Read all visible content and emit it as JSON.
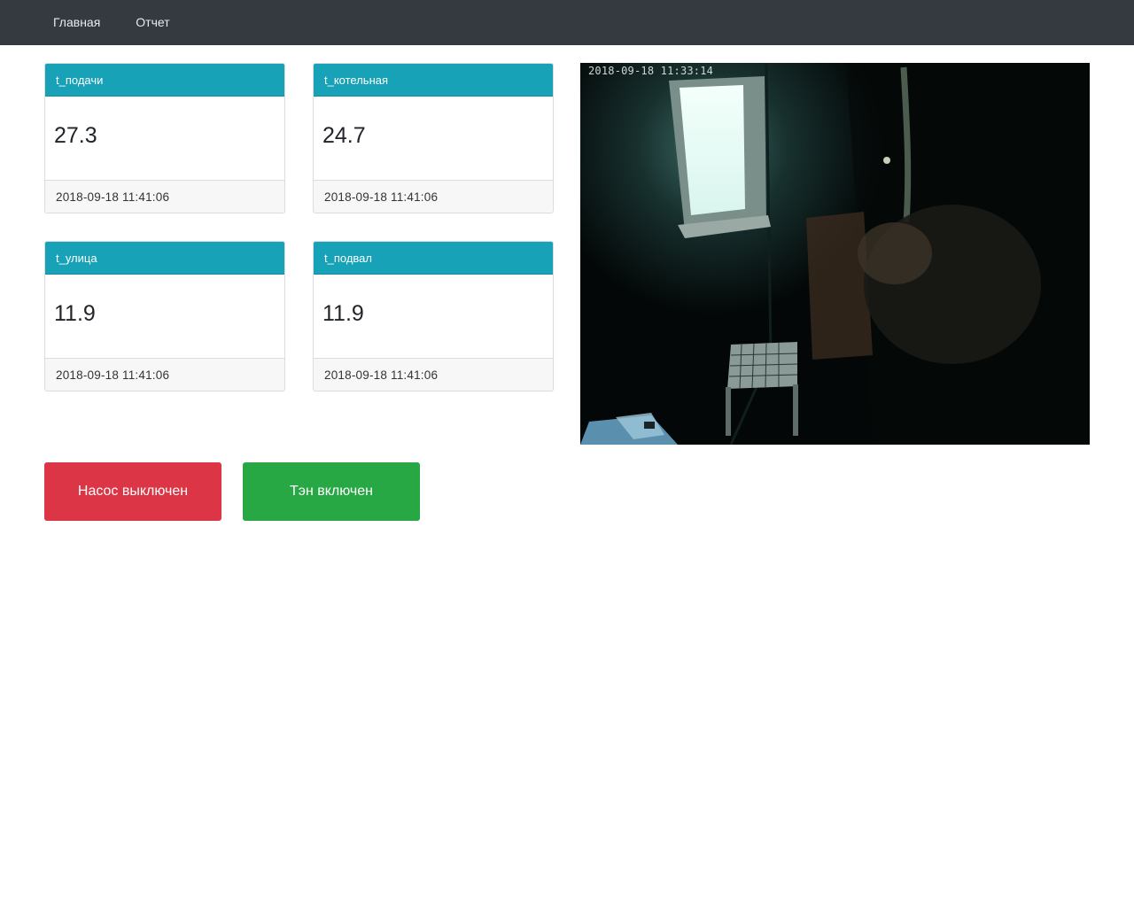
{
  "navbar": {
    "items": [
      {
        "label": "Главная"
      },
      {
        "label": "Отчет"
      }
    ]
  },
  "sensors": [
    {
      "name": "t_подачи",
      "value": "27.3",
      "timestamp": "2018-09-18 11:41:06"
    },
    {
      "name": "t_котельная",
      "value": "24.7",
      "timestamp": "2018-09-18 11:41:06"
    },
    {
      "name": "t_улица",
      "value": "11.9",
      "timestamp": "2018-09-18 11:41:06"
    },
    {
      "name": "t_подвал",
      "value": "11.9",
      "timestamp": "2018-09-18 11:41:06"
    }
  ],
  "camera": {
    "timestamp": "2018-09-18 11:33:14"
  },
  "controls": {
    "pump_label": "Насос выключен",
    "pump_color": "#dc3545",
    "heater_label": "Тэн включен",
    "heater_color": "#28a745"
  },
  "colors": {
    "navbar": "#343a40",
    "card_header": "#17a2b8"
  }
}
